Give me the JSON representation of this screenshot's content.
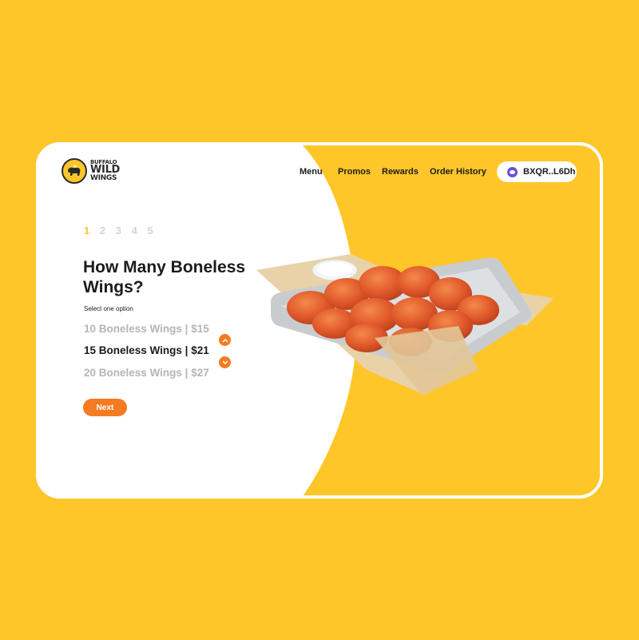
{
  "brand": {
    "line1": "BUFFALO",
    "line2": "WILD",
    "line3": "WINGS",
    "logo_icon": "buffalo-icon"
  },
  "nav": {
    "items": [
      "Menu",
      "Promos",
      "Rewards",
      "Order History"
    ]
  },
  "wallet": {
    "address": "BXQR..L6Dh",
    "icon": "wallet-icon"
  },
  "steps": {
    "items": [
      "1",
      "2",
      "3",
      "4",
      "5"
    ],
    "active": 1
  },
  "question": {
    "title": "How Many Boneless Wings?",
    "subtitle": "Select one option"
  },
  "options": {
    "items": [
      "10 Boneless Wings | $15",
      "15 Boneless Wings | $21",
      "20 Boneless Wings | $27"
    ],
    "selected_index": 1
  },
  "actions": {
    "next_label": "Next"
  },
  "colors": {
    "brand_yellow": "#FFC629",
    "accent_orange": "#F47B20",
    "text_dark": "#1B1B1B",
    "muted_gray": "#B5B5B5"
  }
}
